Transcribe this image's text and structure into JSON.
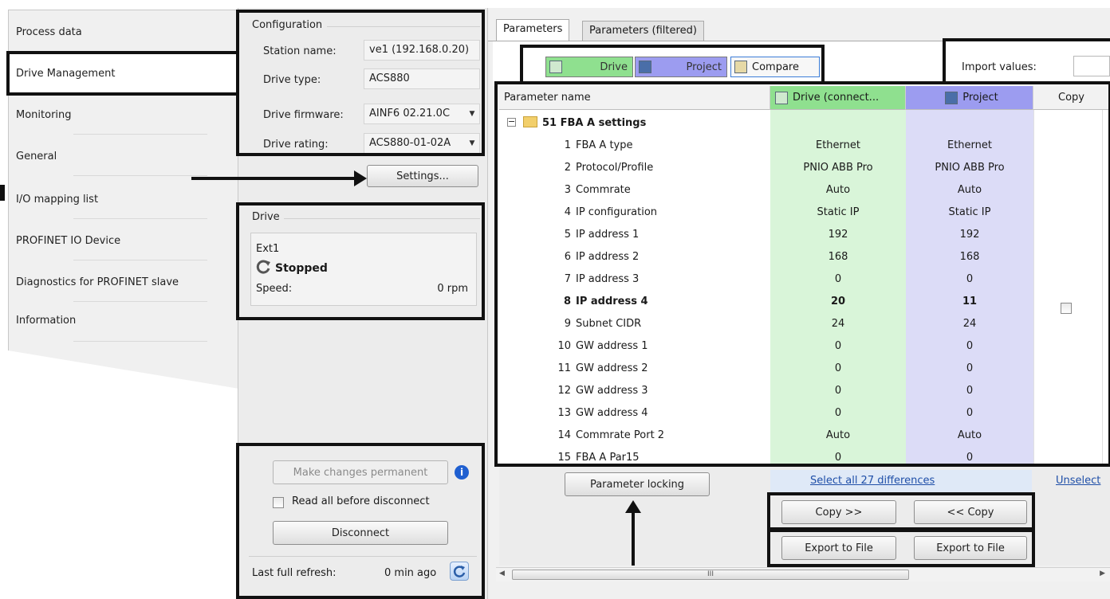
{
  "nav": {
    "items": [
      {
        "label": "Process data"
      },
      {
        "label": "Drive Management"
      },
      {
        "label": "Monitoring"
      },
      {
        "label": "General"
      },
      {
        "label": "I/O mapping list"
      },
      {
        "label": "PROFINET IO Device"
      },
      {
        "label": "Diagnostics for PROFINET slave"
      },
      {
        "label": "Information"
      }
    ]
  },
  "configuration": {
    "title": "Configuration",
    "station_name_label": "Station name:",
    "station_name_value": "ve1 (192.168.0.20)",
    "drive_type_label": "Drive type:",
    "drive_type_value": "ACS880",
    "drive_firmware_label": "Drive firmware:",
    "drive_firmware_value": "AINF6 02.21.0C",
    "drive_rating_label": "Drive rating:",
    "drive_rating_value": "ACS880-01-02A",
    "settings_button": "Settings..."
  },
  "drive": {
    "title": "Drive",
    "control_location": "Ext1",
    "status": "Stopped",
    "speed_label": "Speed:",
    "speed_value": "0 rpm"
  },
  "actions": {
    "make_permanent": "Make changes permanent",
    "read_all_label": "Read all before disconnect",
    "read_all_checked": false,
    "disconnect": "Disconnect",
    "last_refresh_label": "Last full refresh:",
    "last_refresh_value": "0 min ago"
  },
  "tabs": [
    {
      "label": "Parameters",
      "active": true
    },
    {
      "label": "Parameters (filtered)",
      "active": false
    }
  ],
  "toolbar": {
    "drive": "Drive",
    "project": "Project",
    "compare": "Compare",
    "import_label": "Import values:"
  },
  "grid": {
    "headers": {
      "name": "Parameter name",
      "drive": "Drive (connect...",
      "project": "Project",
      "copy": "Copy"
    },
    "group": "51 FBA A settings",
    "rows": [
      {
        "num": "1",
        "name": "FBA A type",
        "drive": "Ethernet",
        "project": "Ethernet",
        "diff": false
      },
      {
        "num": "2",
        "name": "Protocol/Profile",
        "drive": "PNIO ABB Pro",
        "project": "PNIO ABB Pro",
        "diff": false
      },
      {
        "num": "3",
        "name": "Commrate",
        "drive": "Auto",
        "project": "Auto",
        "diff": false
      },
      {
        "num": "4",
        "name": "IP configuration",
        "drive": "Static IP",
        "project": "Static IP",
        "diff": false
      },
      {
        "num": "5",
        "name": "IP address 1",
        "drive": "192",
        "project": "192",
        "diff": false
      },
      {
        "num": "6",
        "name": "IP address 2",
        "drive": "168",
        "project": "168",
        "diff": false
      },
      {
        "num": "7",
        "name": "IP address 3",
        "drive": "0",
        "project": "0",
        "diff": false
      },
      {
        "num": "8",
        "name": "IP address 4",
        "drive": "20",
        "project": "11",
        "diff": true
      },
      {
        "num": "9",
        "name": "Subnet CIDR",
        "drive": "24",
        "project": "24",
        "diff": false
      },
      {
        "num": "10",
        "name": "GW address 1",
        "drive": "0",
        "project": "0",
        "diff": false
      },
      {
        "num": "11",
        "name": "GW address 2",
        "drive": "0",
        "project": "0",
        "diff": false
      },
      {
        "num": "12",
        "name": "GW address 3",
        "drive": "0",
        "project": "0",
        "diff": false
      },
      {
        "num": "13",
        "name": "GW address 4",
        "drive": "0",
        "project": "0",
        "diff": false
      },
      {
        "num": "14",
        "name": "Commrate Port 2",
        "drive": "Auto",
        "project": "Auto",
        "diff": false
      },
      {
        "num": "15",
        "name": "FBA A Par15",
        "drive": "0",
        "project": "0",
        "diff": false
      }
    ]
  },
  "bottom": {
    "parameter_locking": "Parameter locking",
    "select_all": "Select all 27 differences",
    "unselect": "Unselect",
    "copy_right": "Copy >>",
    "copy_left": "<< Copy",
    "export_left": "Export to File",
    "export_right": "Export to File",
    "scroll_mark": "III"
  },
  "colors": {
    "drive_green": "#d9f5d9",
    "drive_green_head": "#8fe08f",
    "project_purple": "#dcdcf7",
    "project_purple_head": "#9c9cf0",
    "link_blue": "#1f4fa8"
  }
}
